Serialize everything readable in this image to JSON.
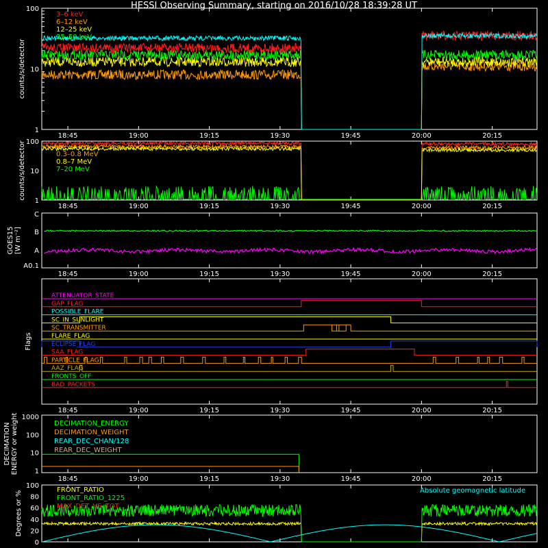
{
  "title": "HESSI Observing Summary, starting on 2016/10/28 18:39:28 UT",
  "chart_data": {
    "type": "line",
    "time_axis": {
      "start": "18:39:28",
      "end": "20:24",
      "tick_labels": [
        "18:45",
        "19:00",
        "19:15",
        "19:30",
        "19:45",
        "20:00",
        "20:15"
      ],
      "tick_minutes": [
        405,
        420,
        435,
        450,
        465,
        480,
        495
      ],
      "range_minutes": [
        399.47,
        504.5
      ]
    },
    "gap": {
      "start_minute": 454.5,
      "end_minute": 480
    },
    "panels": [
      {
        "id": "hxr",
        "ylabel": "counts/s/detector",
        "scale": "log",
        "ylim": [
          1,
          100
        ],
        "y_ticks": [
          "1",
          "10",
          "100"
        ],
        "series": [
          {
            "name": "3–6 keV",
            "color": "#ff2020",
            "before": 22,
            "after": 35
          },
          {
            "name": "6–12 keV",
            "color": "#ff9900",
            "before": 8,
            "after": 11
          },
          {
            "name": "12–25 keV",
            "color": "#ffff00",
            "before": 13,
            "after": 13
          },
          {
            "name": "25–50 keV",
            "color": "#00ff00",
            "before": 17,
            "after": 17
          },
          {
            "name": "",
            "color": "#00ffff",
            "before": 32,
            "after": 35
          }
        ]
      },
      {
        "id": "gamma",
        "ylabel": "counts/s/detector",
        "scale": "log",
        "ylim": [
          1,
          100
        ],
        "y_ticks": [
          "1",
          "10",
          "100"
        ],
        "series": [
          {
            "name": "",
            "color": "#ff2020",
            "before": 85,
            "after": 80
          },
          {
            "name": "0.3–0.8 MeV",
            "color": "#ff9900",
            "before": 65,
            "after": 60
          },
          {
            "name": "0.8–7 MeV",
            "color": "#ffff00",
            "before": 55,
            "after": 50
          },
          {
            "name": "7–20 MeV",
            "color": "#00ff00",
            "before": 1.3,
            "after": 1.3
          }
        ]
      },
      {
        "id": "goes",
        "ylabel": "GOES15",
        "ylabel2": "[W m⁻²]",
        "scale": "log",
        "y_ticks": [
          "A0.1",
          "A",
          "B",
          "C"
        ],
        "series": [
          {
            "name": "",
            "color": "#00ff00",
            "level": "B",
            "value": 0.8
          },
          {
            "name": "",
            "color": "#ff00ff",
            "level": "A",
            "value": 0.27
          }
        ]
      },
      {
        "id": "flags",
        "ylabel": "Flags",
        "flags": [
          {
            "name": "ATTENUATOR_STATE",
            "color": "#ff00ff",
            "on": []
          },
          {
            "name": "GAP_FLAG",
            "color": "#ff2020",
            "on": [
              [
                454.5,
                480
              ]
            ]
          },
          {
            "name": "POSSIBLE_FLARE",
            "color": "#00ffff",
            "on": []
          },
          {
            "name": "SC_IN_SUNLIGHT",
            "color": "#ffff00",
            "on": [
              [
                407.5,
                473.5
              ]
            ]
          },
          {
            "name": "SC_TRANSMITTER",
            "color": "#ff9900",
            "on": [
              [
                455,
                464
              ],
              [
                461,
                462
              ],
              [
                462.5,
                465
              ]
            ]
          },
          {
            "name": "FLARE_FLAG",
            "color": "#ffff00",
            "on": []
          },
          {
            "name": "ECLIPSE_FLAG",
            "color": "#2040ff",
            "on": [
              [
                399.47,
                407.5
              ],
              [
                473.5,
                504.5
              ]
            ]
          },
          {
            "name": "SAA_FLAG",
            "color": "#ff2020",
            "on": [
              [
                455.5,
                478.5
              ]
            ]
          },
          {
            "name": "PARTICLE_FLAG",
            "color": "#ff9900",
            "on": "bursts"
          },
          {
            "name": "AAZ_FLAG",
            "color": "#ccaa00",
            "on": [
              [
                407.5,
                408
              ],
              [
                473.5,
                474
              ]
            ]
          },
          {
            "name": "FRONTS_OFF",
            "color": "#00ff00",
            "on": []
          },
          {
            "name": "BAD_PACKETS",
            "color": "#ff2020",
            "on": [
              [
                498,
                498.3
              ]
            ]
          }
        ]
      },
      {
        "id": "decimation",
        "ylabel": "DECIMATION",
        "ylabel2": "ENERGY or weight",
        "scale": "log",
        "ylim": [
          1,
          1000
        ],
        "y_ticks": [
          "1",
          "10",
          "100",
          "1000"
        ],
        "series": [
          {
            "name": "DECIMATION_ENERGY",
            "color": "#00ff00",
            "value": 8,
            "until": 454
          },
          {
            "name": "DECIMATION_WEIGHT",
            "color": "#ff9900",
            "value": 1.7,
            "until": 454
          },
          {
            "name": "REAR_DEC_CHAN/128",
            "color": "#00ffff",
            "value": null
          },
          {
            "name": "REAR_DEC_WEIGHT",
            "color": "#ccaa88",
            "value": null
          }
        ]
      },
      {
        "id": "ratios",
        "ylabel": "Degrees or %",
        "scale": "linear",
        "ylim": [
          0,
          100
        ],
        "y_ticks": [
          "0",
          "20",
          "40",
          "60",
          "80",
          "100"
        ],
        "series": [
          {
            "name": "FRONT_RATIO",
            "color": "#ffff00",
            "value": 32
          },
          {
            "name": "FRONT_RATIO_1225",
            "color": "#00ff00",
            "value": 55
          },
          {
            "name": "MAX_DET_VS_TOT",
            "color": "#ff2020",
            "value": null
          },
          {
            "name": "Absolute geomagnetic latitude",
            "color": "#00ffff",
            "type": "arc"
          }
        ]
      }
    ]
  }
}
